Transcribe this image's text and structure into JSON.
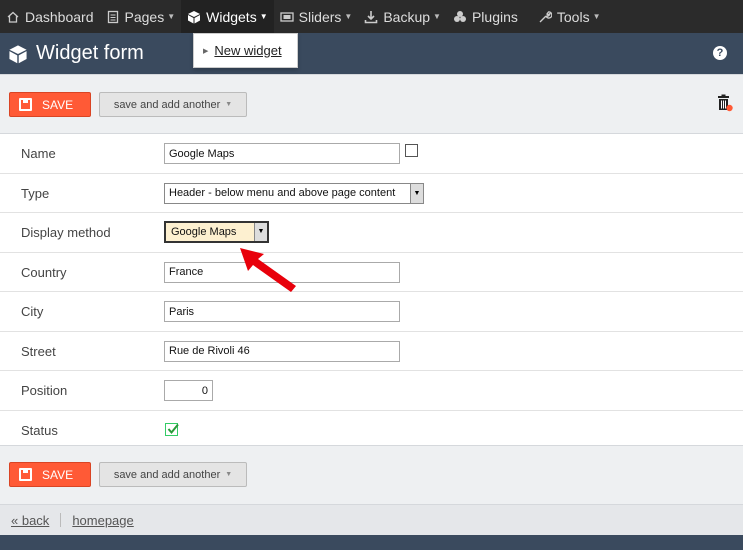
{
  "nav": {
    "items": [
      {
        "label": "Dashboard",
        "icon": "home-icon",
        "caret": ""
      },
      {
        "label": "Pages",
        "icon": "document-icon",
        "caret": "▼"
      },
      {
        "label": "Widgets",
        "icon": "cube-icon",
        "caret": "▼"
      },
      {
        "label": "Sliders",
        "icon": "slides-icon",
        "caret": "▼"
      },
      {
        "label": "Backup",
        "icon": "download-icon",
        "caret": "▼"
      },
      {
        "label": "Plugins",
        "icon": "puzzle-icon",
        "caret": ""
      },
      {
        "label": "Tools",
        "icon": "wrench-icon",
        "caret": "▼"
      }
    ],
    "active": "Widgets",
    "dropdown": {
      "marker": "▶",
      "item": "New widget"
    }
  },
  "header": {
    "title": "Widget form",
    "help": "?"
  },
  "actions": {
    "save_label": "SAVE",
    "save_another_label": "save and add another",
    "caret": "▼"
  },
  "form": {
    "name": {
      "label": "Name",
      "value": "Google Maps"
    },
    "type": {
      "label": "Type",
      "value": "Header - below menu and above page content"
    },
    "display_method": {
      "label": "Display method",
      "value": "Google Maps"
    },
    "country": {
      "label": "Country",
      "value": "France"
    },
    "city": {
      "label": "City",
      "value": "Paris"
    },
    "street": {
      "label": "Street",
      "value": "Rue de Rivoli 46"
    },
    "position": {
      "label": "Position",
      "value": "0"
    },
    "status": {
      "label": "Status",
      "checked": true
    }
  },
  "footer": {
    "back": "« back",
    "homepage": "homepage"
  },
  "colors": {
    "nav_bg": "#2b2b2b",
    "header_bg": "#3a4a5e",
    "save_button": "#ff5a36",
    "annotation_arrow": "#e8000b"
  }
}
